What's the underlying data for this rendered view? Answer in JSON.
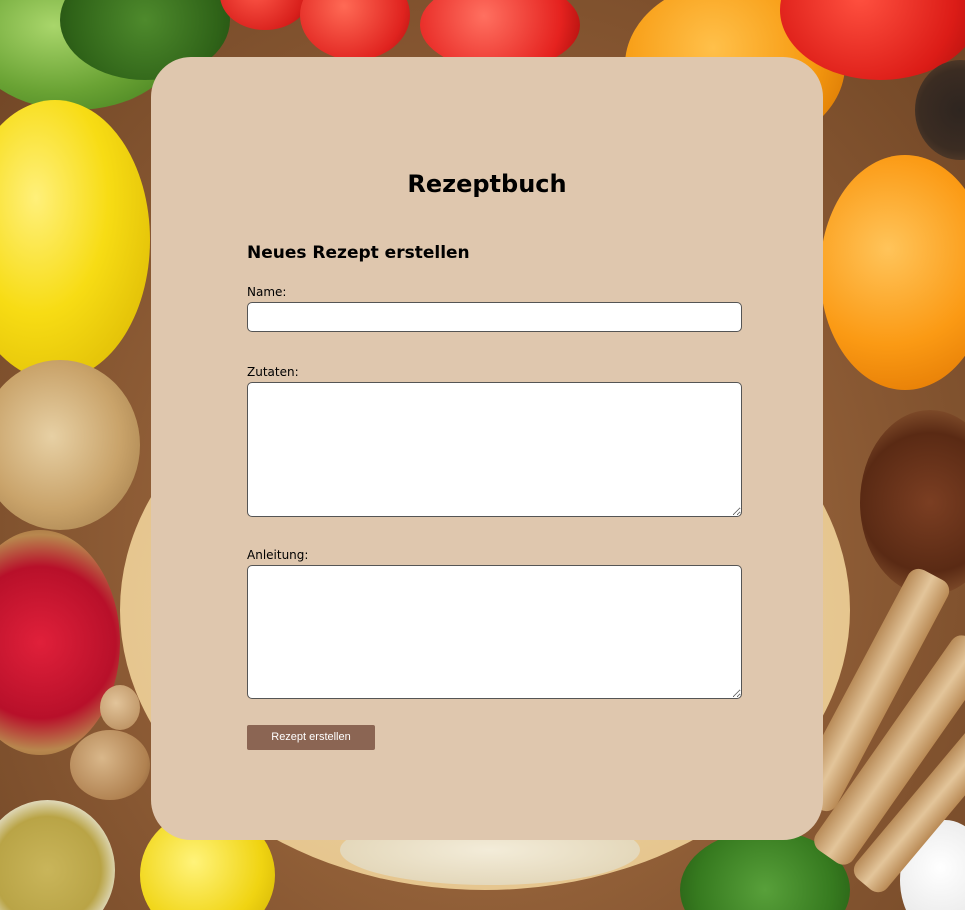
{
  "app": {
    "title": "Rezeptbuch"
  },
  "form": {
    "heading": "Neues Rezept erstellen",
    "name_label": "Name:",
    "name_value": "",
    "ingredients_label": "Zutaten:",
    "ingredients_value": "",
    "instructions_label": "Anleitung:",
    "instructions_value": "",
    "submit_label": "Rezept erstellen"
  },
  "colors": {
    "card_background": "#dfc7ae",
    "button_background": "#8b6553",
    "button_text": "#ffffff"
  },
  "background": {
    "image": "vegetables-food-photo"
  }
}
